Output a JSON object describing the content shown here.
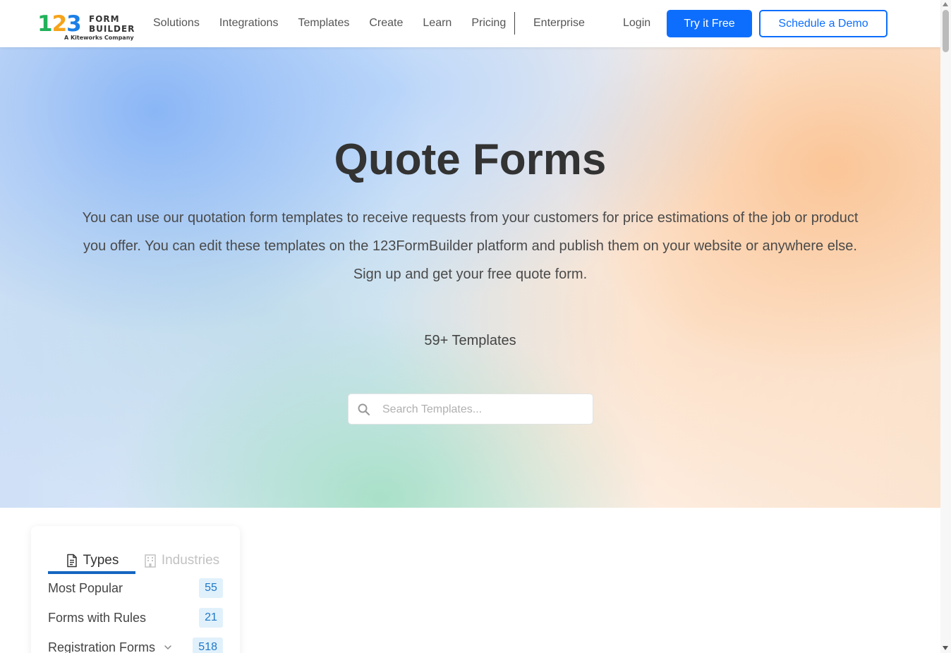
{
  "brand": {
    "digits": [
      "1",
      "2",
      "3"
    ],
    "word_line1": "FORM",
    "word_line2": "BUILDER",
    "tagline": "A Kiteworks Company",
    "colors": {
      "one": "#22b15a",
      "two": "#f6a31a",
      "three": "#1c7fe6"
    }
  },
  "nav": {
    "items": [
      "Solutions",
      "Integrations",
      "Templates",
      "Create",
      "Learn",
      "Pricing"
    ],
    "enterprise": "Enterprise",
    "login": "Login",
    "try_free": "Try it Free",
    "schedule_demo": "Schedule a Demo"
  },
  "hero": {
    "title": "Quote Forms",
    "description": "You can use our quotation form templates to receive requests from your customers for price estimations of the job or product you offer. You can edit these templates on the 123FormBuilder platform and publish them on your website or anywhere else. Sign up and get your free quote form.",
    "count": "59+ Templates"
  },
  "search": {
    "placeholder": "Search Templates...",
    "icon": "search-icon"
  },
  "sidebar": {
    "tabs": [
      {
        "label": "Types",
        "icon": "document-icon",
        "active": true
      },
      {
        "label": "Industries",
        "icon": "building-icon",
        "active": false
      }
    ],
    "categories": [
      {
        "label": "Most Popular",
        "count": "55"
      },
      {
        "label": "Forms with Rules",
        "count": "21"
      },
      {
        "label": "Registration Forms",
        "count": "518",
        "expandable": true
      }
    ]
  },
  "colors": {
    "primary": "#0d6efd",
    "active_tab": "#1565c0",
    "badge_bg": "#e1f1fb",
    "badge_text": "#1e78c8"
  }
}
